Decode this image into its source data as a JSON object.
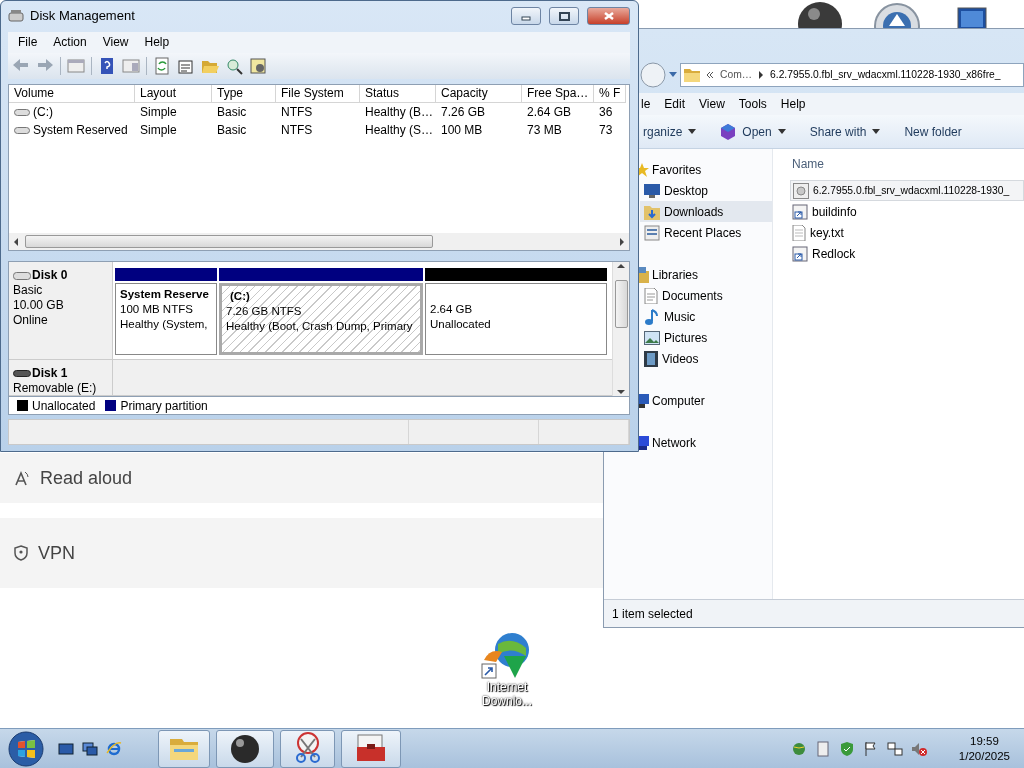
{
  "settings_list": [
    {
      "label": "Read aloud",
      "kind": "read"
    },
    {
      "label": "VPN",
      "kind": "vpn"
    }
  ],
  "explorer": {
    "address": {
      "crumbs": [
        "Com…",
        "6.2.7955.0.fbl_srv_wdacxml.110228-1930_x86fre_"
      ]
    },
    "menu": [
      "le",
      "Edit",
      "View",
      "Tools",
      "Help"
    ],
    "toolbar": [
      {
        "label": "rganize",
        "dropdown": true,
        "kind": "plain"
      },
      {
        "label": "Open",
        "dropdown": true,
        "kind": "open"
      },
      {
        "label": "Share with",
        "dropdown": true,
        "kind": "plain"
      },
      {
        "label": "New folder",
        "dropdown": false,
        "kind": "plain"
      }
    ],
    "nav": [
      {
        "label": "Favorites",
        "kind": "star",
        "children": [
          {
            "label": "Desktop",
            "kind": "monitor",
            "selected": false
          },
          {
            "label": "Downloads",
            "kind": "download",
            "selected": true
          },
          {
            "label": "Recent Places",
            "kind": "recent",
            "selected": false
          }
        ]
      },
      {
        "label": "Libraries",
        "kind": "library",
        "children": [
          {
            "label": "Documents",
            "kind": "document",
            "selected": false
          },
          {
            "label": "Music",
            "kind": "music",
            "selected": false
          },
          {
            "label": "Pictures",
            "kind": "pictures",
            "selected": false
          },
          {
            "label": "Videos",
            "kind": "video",
            "selected": false
          }
        ]
      },
      {
        "label": "Computer",
        "kind": "computer"
      },
      {
        "label": "Network",
        "kind": "network"
      }
    ],
    "column": "Name",
    "files": [
      {
        "name": "6.2.7955.0.fbl_srv_wdacxml.110228-1930_",
        "kind": "setup",
        "selected": true
      },
      {
        "name": "buildinfo",
        "kind": "shortcut",
        "selected": false
      },
      {
        "name": "key.txt",
        "kind": "text",
        "selected": false
      },
      {
        "name": "Redlock",
        "kind": "shortcut",
        "selected": false
      }
    ],
    "status": "1 item selected"
  },
  "disk_management": {
    "title": "Disk Management",
    "menu": [
      "File",
      "Action",
      "View",
      "Help"
    ],
    "columns": [
      "Volume",
      "Layout",
      "Type",
      "File System",
      "Status",
      "Capacity",
      "Free Spa…",
      "% F"
    ],
    "volumes": [
      {
        "cells": [
          "(C:)",
          "Simple",
          "Basic",
          "NTFS",
          "Healthy (B…",
          "7.26 GB",
          "2.64 GB",
          "36"
        ]
      },
      {
        "cells": [
          "System Reserved",
          "Simple",
          "Basic",
          "NTFS",
          "Healthy (S…",
          "100 MB",
          "73 MB",
          "73"
        ]
      }
    ],
    "disks": [
      {
        "name": "Disk 0",
        "kind": "basic",
        "lines": [
          "Basic",
          "10.00 GB",
          "Online"
        ],
        "partitions": [
          {
            "name": "System Reserve",
            "size": "100 MB NTFS",
            "status": "Healthy (System,",
            "color": "#000080",
            "selected": false
          },
          {
            "name": "(C:)",
            "size": "7.26 GB NTFS",
            "status": "Healthy (Boot, Crash Dump, Primary",
            "color": "#000080",
            "selected": true
          },
          {
            "size": "2.64 GB",
            "status": "Unallocated",
            "color": "#000000",
            "selected": false
          }
        ]
      },
      {
        "name": "Disk 1",
        "kind": "removable",
        "lines": [
          "Removable (E:)"
        ]
      }
    ],
    "legend": [
      {
        "label": "Unallocated",
        "color": "#000000"
      },
      {
        "label": "Primary partition",
        "color": "#000080"
      }
    ]
  },
  "desktop_shortcut": {
    "label": "Internet Downlo..."
  },
  "clock": {
    "time": "19:59",
    "date": "1/20/2025"
  }
}
